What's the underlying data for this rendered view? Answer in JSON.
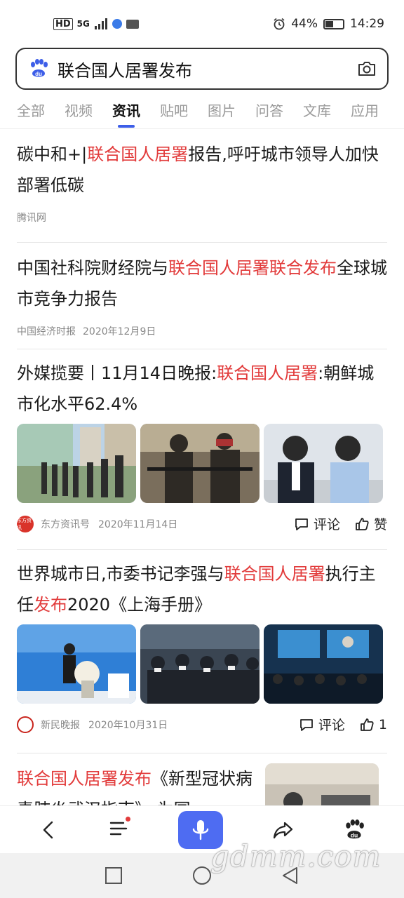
{
  "status_bar": {
    "hd": "HD",
    "network": "5G",
    "battery": "44%",
    "battery_level": 0.44,
    "time": "14:29"
  },
  "search": {
    "query": "联合国人居署发布"
  },
  "tabs": [
    {
      "label": "全部",
      "active": false
    },
    {
      "label": "视频",
      "active": false
    },
    {
      "label": "资讯",
      "active": true
    },
    {
      "label": "贴吧",
      "active": false
    },
    {
      "label": "图片",
      "active": false
    },
    {
      "label": "问答",
      "active": false
    },
    {
      "label": "文库",
      "active": false
    },
    {
      "label": "应用",
      "active": false
    }
  ],
  "articles": [
    {
      "title_parts": [
        {
          "t": "碳中和+|",
          "hl": false
        },
        {
          "t": "联合国人居署",
          "hl": true
        },
        {
          "t": "报告,呼吁城市领导人加快部署低碳",
          "hl": false
        }
      ],
      "source": "腾讯网",
      "date": ""
    },
    {
      "title_parts": [
        {
          "t": "中国社科院财经院与",
          "hl": false
        },
        {
          "t": "联合国人居署联合发布",
          "hl": true
        },
        {
          "t": "全球城市竞争力报告",
          "hl": false
        }
      ],
      "source": "中国经济时报",
      "date": "2020年12月9日"
    },
    {
      "title_parts": [
        {
          "t": "外媒揽要丨11月14日晚报:",
          "hl": false
        },
        {
          "t": "联合国人居署",
          "hl": true
        },
        {
          "t": ":朝鲜城市化水平62.4%",
          "hl": false
        }
      ],
      "source": "东方资讯号",
      "date": "2020年11月14日",
      "logo_text": "东方资讯",
      "comment": "评论",
      "like": "赞"
    },
    {
      "title_parts": [
        {
          "t": "世界城市日,市委书记李强与",
          "hl": false
        },
        {
          "t": "联合国人居署",
          "hl": true
        },
        {
          "t": "执行主任",
          "hl": false
        },
        {
          "t": "发布",
          "hl": true
        },
        {
          "t": "2020《上海手册》",
          "hl": false
        }
      ],
      "source": "新民晚报",
      "date": "2020年10月31日",
      "comment": "评论",
      "like": "1"
    },
    {
      "title_parts": [
        {
          "t": "联合国人居署发布",
          "hl": true
        },
        {
          "t": "《新型冠状病毒肺炎武汉指南》,为国",
          "hl": false
        }
      ]
    }
  ],
  "watermark": "gdmm.com",
  "colors": {
    "highlight": "#e23b3b",
    "accent": "#3d5ee8",
    "mic": "#4e6cf2"
  }
}
